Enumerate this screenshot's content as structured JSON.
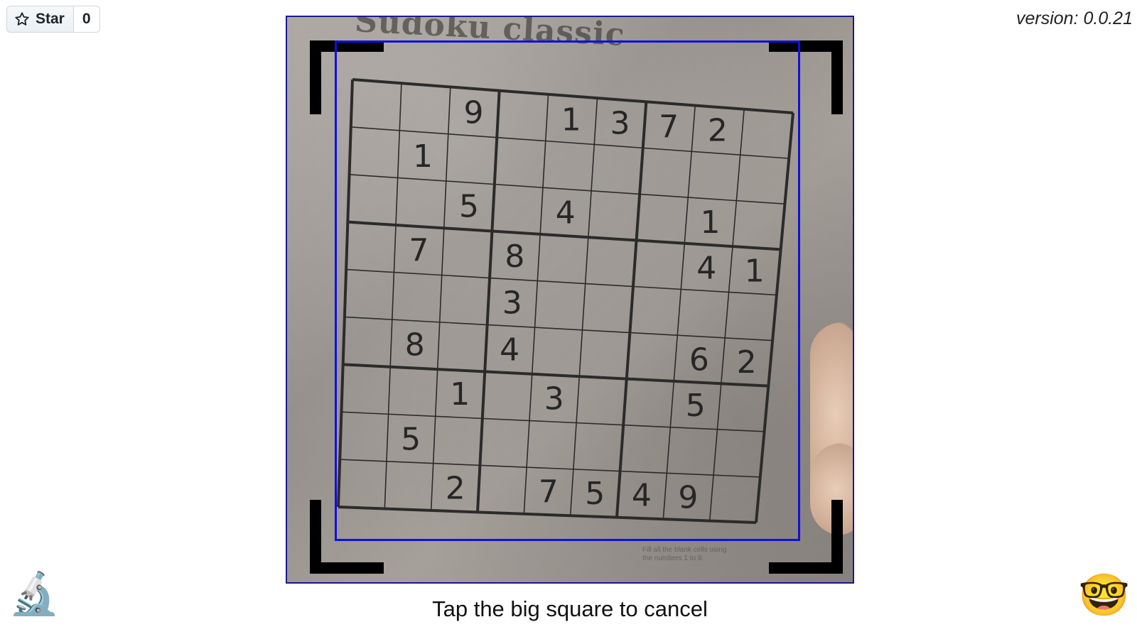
{
  "github": {
    "star_label": "Star",
    "star_count": "0"
  },
  "version_label": "version: 0.0.21",
  "camera": {
    "paper_title": "Sudoku classic",
    "fine_print": "Fill all the blank cells using the numbers 1 to 9.",
    "grid": [
      [
        "",
        "",
        "9",
        "",
        "1",
        "3",
        "7",
        "2",
        ""
      ],
      [
        "",
        "1",
        "",
        "",
        "",
        "",
        "",
        "",
        ""
      ],
      [
        "",
        "",
        "5",
        "",
        "4",
        "",
        "",
        "1",
        ""
      ],
      [
        "",
        "7",
        "",
        "8",
        "",
        "",
        "",
        "4",
        "1"
      ],
      [
        "",
        "",
        "",
        "3",
        "",
        "",
        "",
        "",
        ""
      ],
      [
        "",
        "8",
        "",
        "4",
        "",
        "",
        "",
        "6",
        "2"
      ],
      [
        "",
        "",
        "1",
        "",
        "3",
        "",
        "",
        "5",
        ""
      ],
      [
        "",
        "5",
        "",
        "",
        "",
        "",
        "",
        "",
        ""
      ],
      [
        "",
        "",
        "2",
        "",
        "7",
        "5",
        "4",
        "9",
        ""
      ]
    ]
  },
  "instruction": "Tap the big square to cancel",
  "icons": {
    "left": "microscope-icon",
    "right": "nerd-face-icon"
  },
  "colors": {
    "detect_box": "#1010e0",
    "viewport_border": "#1a1a8e"
  }
}
